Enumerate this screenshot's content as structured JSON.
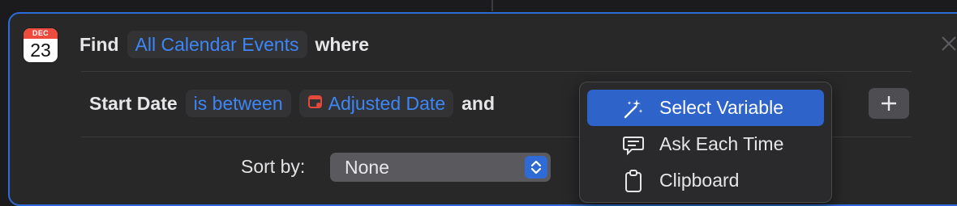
{
  "calendar_icon": {
    "month": "DEC",
    "day": "23"
  },
  "find_row": {
    "find_label": "Find",
    "entity": "All Calendar Events",
    "where_label": "where"
  },
  "filter": {
    "field": "Start Date",
    "operator": "is between",
    "variable": "Adjusted Date",
    "and_label": "and"
  },
  "add_button_symbol": "+",
  "sort": {
    "label": "Sort by:",
    "value": "None"
  },
  "menu": {
    "items": [
      {
        "label": "Select Variable",
        "icon": "magic-wand-icon",
        "selected": true
      },
      {
        "label": "Ask Each Time",
        "icon": "speech-bubble-icon",
        "selected": false
      },
      {
        "label": "Clipboard",
        "icon": "clipboard-icon",
        "selected": false
      }
    ]
  },
  "colors": {
    "accent": "#2f6bd7",
    "token_text": "#3d86f5",
    "variable_icon": "#e5493a",
    "menu_highlight": "#2e63c9"
  }
}
